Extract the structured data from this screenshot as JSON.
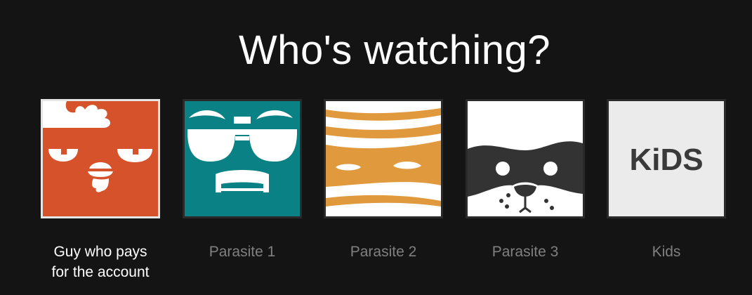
{
  "heading": "Who's watching?",
  "profiles": [
    {
      "name": "Guy who pays\nfor the account",
      "avatar": "chicken-avatar-icon",
      "color": "#d5522b",
      "selected": true
    },
    {
      "name": "Parasite 1",
      "avatar": "sunglasses-face-avatar-icon",
      "color": "#0a8285",
      "selected": false
    },
    {
      "name": "Parasite 2",
      "avatar": "mummy-avatar-icon",
      "color": "#e09a3d",
      "selected": false
    },
    {
      "name": "Parasite 3",
      "avatar": "raccoon-mask-avatar-icon",
      "color": "#333333",
      "selected": false
    },
    {
      "name": "Kids",
      "avatar": "kids-avatar-icon",
      "color": "#ebebeb",
      "selected": false,
      "logo_text": "KiDS"
    }
  ]
}
